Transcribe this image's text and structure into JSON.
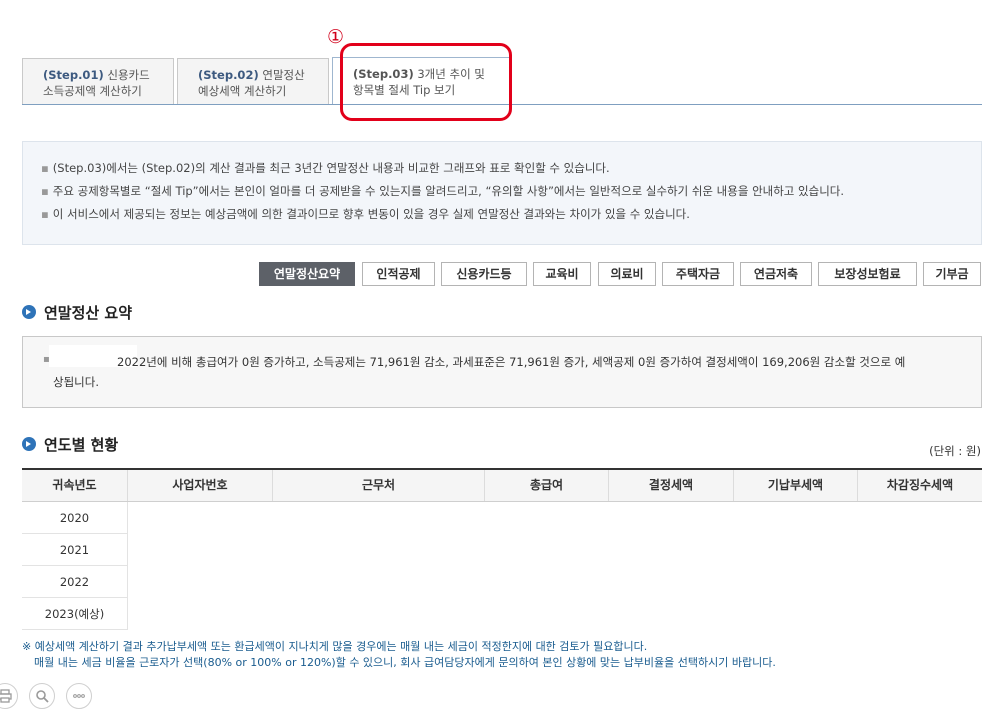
{
  "tabs": [
    {
      "step": "(Step.01)",
      "line1_rest": " 신용카드",
      "line2": "소득공제액 계산하기"
    },
    {
      "step": "(Step.02)",
      "line1_rest": " 연말정산",
      "line2": "예상세액 계산하기"
    },
    {
      "step": "(Step.03)",
      "line1_rest": " 3개년 추이 및",
      "line2": "항목별 절세 Tip 보기"
    }
  ],
  "annotation": {
    "number": "①"
  },
  "info_lines": [
    "(Step.03)에서는 (Step.02)의 계산 결과를 최근 3년간 연말정산 내용과 비교한 그래프와 표로 확인할 수 있습니다.",
    "주요 공제항목별로 “절세 Tip”에서는 본인이 얼마를 더 공제받을 수 있는지를 알려드리고, “유의할 사항”에서는 일반적으로 실수하기 쉬운 내용을 안내하고 있습니다.",
    "이 서비스에서 제공되는 정보는 예상금액에 의한 결과이므로 향후 변동이 있을 경우 실제 연말정산 결과와는 차이가 있을 수 있습니다."
  ],
  "categories": [
    "연말정산요약",
    "인적공제",
    "신용카드등",
    "교육비",
    "의료비",
    "주택자금",
    "연금저축",
    "보장성보험료",
    "기부금"
  ],
  "summary": {
    "title": "연말정산 요약",
    "line1": "2022년에 비해 총급여가 0원 증가하고, 소득공제는 71,961원 감소, 과세표준은 71,961원 증가, 세액공제 0원 증가하여 결정세액이 169,206원 감소할 것으로 예",
    "line2": "상됩니다."
  },
  "yearly": {
    "title": "연도별 현황",
    "unit": "(단위 : 원)",
    "columns": [
      "귀속년도",
      "사업자번호",
      "근무처",
      "총급여",
      "결정세액",
      "기납부세액",
      "차감징수세액"
    ],
    "years": [
      "2020",
      "2021",
      "2022",
      "2023(예상)"
    ]
  },
  "notes": [
    "※ 예상세액 계산하기 결과 추가납부세액 또는 환급세액이 지나치게 많을 경우에는 매월 내는 세금이 적정한지에 대한 검토가 필요합니다.",
    "매월 내는 세금 비율을 근로자가 선택(80% or 100% or 120%)할 수 있으니, 회사 급여담당자에게 문의하여 본인 상황에 맞는 납부비율을 선택하시기 바랍니다."
  ],
  "bottom_icons": [
    "print-icon",
    "zoom-icon",
    "more-icon"
  ],
  "colors": {
    "highlight": "#e2001a",
    "active_button": "#5d6168",
    "section_icon": "#2e73b8",
    "note_text": "#1a5c8f"
  }
}
